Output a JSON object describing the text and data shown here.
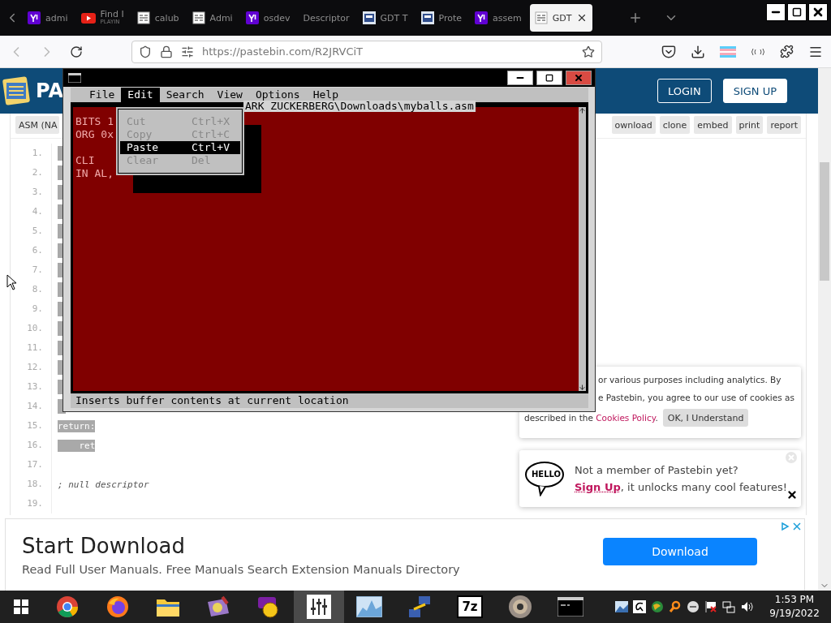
{
  "browser": {
    "tabs": [
      {
        "title": "admi",
        "kind": "yahoo",
        "selected": false
      },
      {
        "title": "Find I",
        "subtitle": "PLAYIN",
        "kind": "video",
        "selected": false
      },
      {
        "title": "calub",
        "kind": "document",
        "selected": false
      },
      {
        "title": "Admi",
        "kind": "document",
        "selected": false
      },
      {
        "title": "osdev",
        "kind": "yahoo",
        "selected": false
      },
      {
        "title": "Descriptor",
        "kind": "plain",
        "selected": false
      },
      {
        "title": "GDT T",
        "kind": "image",
        "selected": false
      },
      {
        "title": "Prote",
        "kind": "image",
        "selected": false
      },
      {
        "title": "assem",
        "kind": "yahoo",
        "selected": false
      },
      {
        "title": "GDT",
        "kind": "document",
        "selected": true
      }
    ],
    "url": "https://pastebin.com/R2JRVCiT"
  },
  "site": {
    "logo_text": "PA",
    "login": "LOGIN",
    "signup": "SIGN UP"
  },
  "paste_toolbar": {
    "syntax": "ASM (NA",
    "actions": [
      "ownload",
      "clone",
      "embed",
      "print",
      "report"
    ]
  },
  "code_lines": [
    {
      "number": "1.",
      "kind": "block"
    },
    {
      "number": "2.",
      "kind": "stub"
    },
    {
      "number": "3.",
      "kind": "block"
    },
    {
      "number": "4.",
      "kind": "block"
    },
    {
      "number": "5.",
      "kind": "block"
    },
    {
      "number": "6.",
      "kind": "block"
    },
    {
      "number": "7.",
      "kind": "block"
    },
    {
      "number": "8.",
      "kind": "block"
    },
    {
      "number": "9.",
      "kind": "block"
    },
    {
      "number": "10.",
      "kind": "block"
    },
    {
      "number": "11.",
      "kind": "block"
    },
    {
      "number": "12.",
      "kind": "block"
    },
    {
      "number": "13.",
      "kind": "block"
    },
    {
      "number": "14.",
      "kind": "stub"
    },
    {
      "number": "15.",
      "kind": "highlight",
      "text": "return:"
    },
    {
      "number": "16.",
      "kind": "highlight",
      "text": "    ret"
    },
    {
      "number": "17.",
      "kind": "empty"
    },
    {
      "number": "18.",
      "kind": "comment",
      "text": "; null descriptor"
    },
    {
      "number": "19.",
      "kind": "empty"
    }
  ],
  "editor_window": {
    "menu": [
      {
        "label": "File",
        "selected": false
      },
      {
        "label": "Edit",
        "selected": true
      },
      {
        "label": "Search",
        "selected": false
      },
      {
        "label": "View",
        "selected": false
      },
      {
        "label": "Options",
        "selected": false
      },
      {
        "label": "Help",
        "selected": false
      }
    ],
    "dropdown": [
      {
        "label": "Cut",
        "shortcut": "Ctrl+X",
        "disabled": true,
        "selected": false
      },
      {
        "label": "Copy",
        "shortcut": "Ctrl+C",
        "disabled": true,
        "selected": false
      },
      {
        "label": "Paste",
        "shortcut": "Ctrl+V",
        "disabled": false,
        "selected": true
      },
      {
        "label": "Clear",
        "shortcut": "Del",
        "disabled": true,
        "selected": false
      }
    ],
    "file_title": "ARK ZUCKERBERG\\Downloads\\myballs.asm",
    "lines": [
      {
        "kind": "text",
        "text": "BITS 1"
      },
      {
        "kind": "text",
        "text": "ORG 0x"
      },
      {
        "kind": "blank"
      },
      {
        "kind": "text",
        "text": "CLI"
      },
      {
        "kind": "text",
        "text": "IN AL,"
      }
    ],
    "status": "Inserts buffer contents at current location"
  },
  "cookie_notice": {
    "lines": [
      "or various purposes including analytics. By",
      "e Pastebin, you agree to our use of cookies as"
    ],
    "lead": "described in the",
    "link": "Cookies Policy",
    "tail": ".",
    "button": "OK, I Understand"
  },
  "signup_prompt": {
    "badge": "HELLO",
    "title": "Not a member of Pastebin yet?",
    "link": "Sign Up",
    "text": ", it unlocks many cool features!"
  },
  "ad": {
    "title": "Start Download",
    "text": "Read Full User Manuals. Free Manuals Search Extension Manuals Directory",
    "button": "Download"
  },
  "taskbar": {
    "apps": [
      {
        "kind": "chrome",
        "selected": false
      },
      {
        "kind": "firefox",
        "selected": false
      },
      {
        "kind": "folder",
        "selected": false
      },
      {
        "kind": "paint",
        "selected": false
      },
      {
        "kind": "messenger",
        "selected": false
      },
      {
        "kind": "mixer",
        "selected": true
      },
      {
        "kind": "chart",
        "selected": false
      },
      {
        "kind": "network",
        "selected": false
      },
      {
        "kind": "archive",
        "label": "7z",
        "selected": false
      },
      {
        "kind": "disc",
        "selected": false
      },
      {
        "kind": "terminal",
        "selected": false
      }
    ],
    "time": "1:53 PM",
    "date": "9/19/2022"
  }
}
